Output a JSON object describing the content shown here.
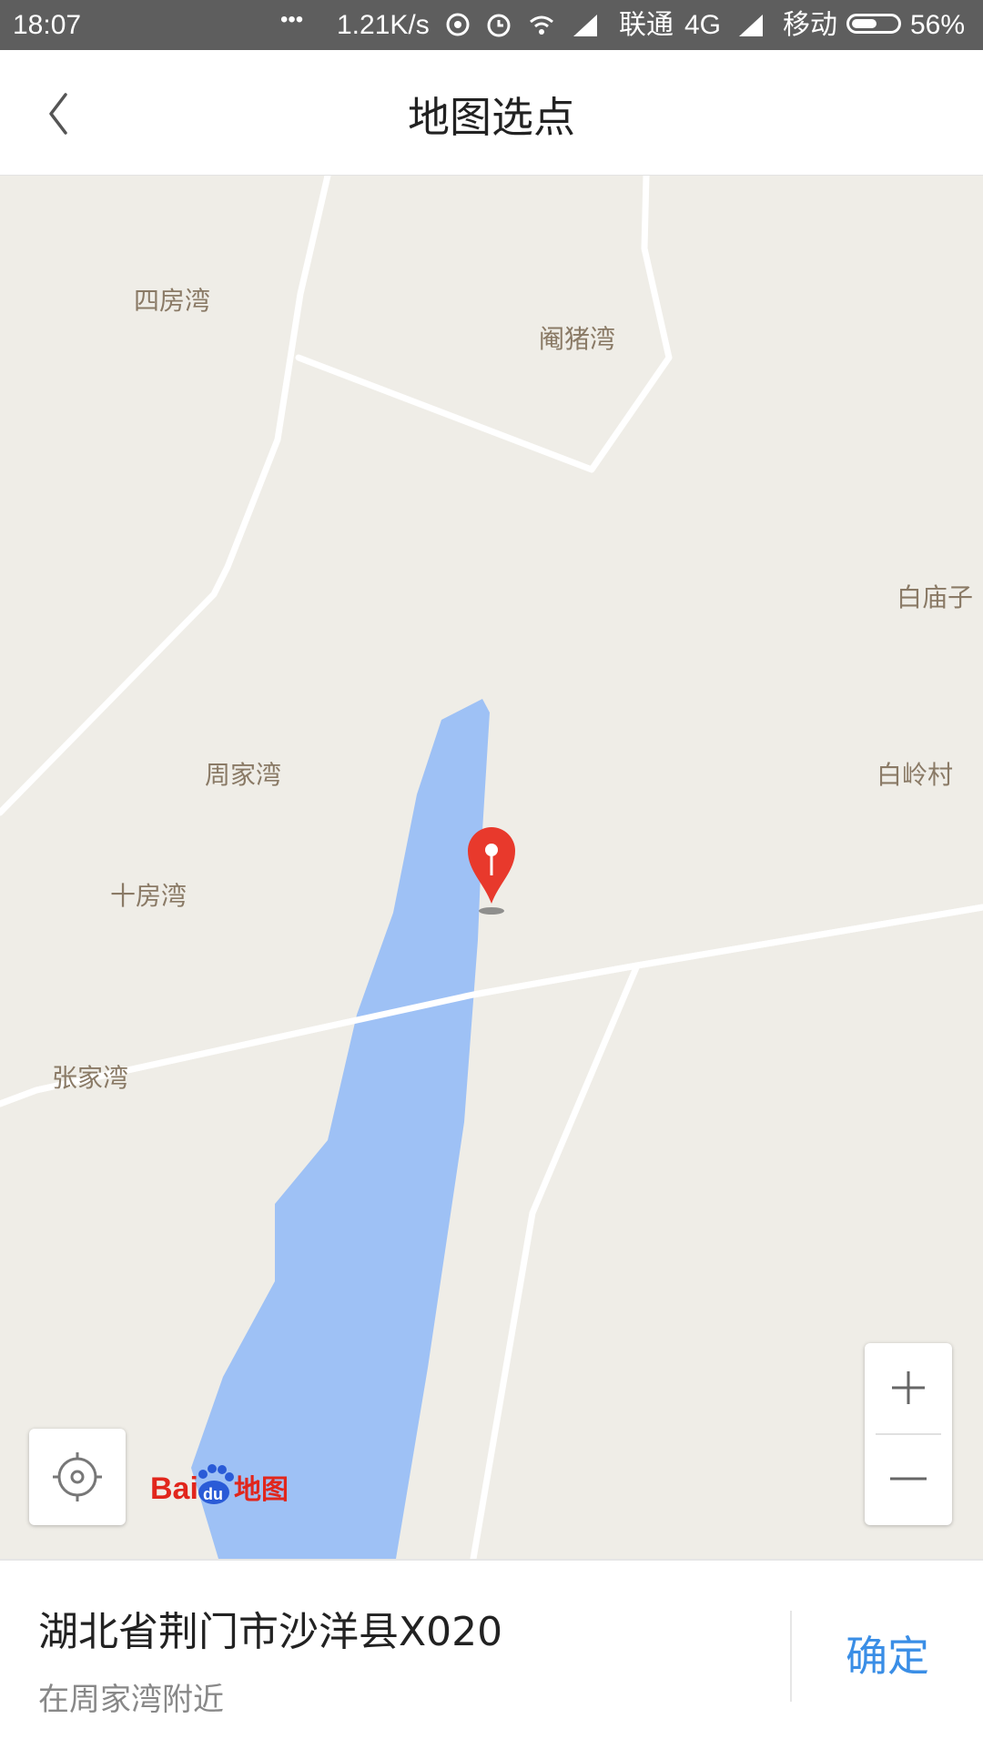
{
  "status_bar": {
    "time": "18:07",
    "dots": "•••",
    "speed": "1.21K/s",
    "carrier1": "联通",
    "network": "4G",
    "carrier2": "移动",
    "battery": "56%",
    "battery_level": 0.56,
    "icons": [
      "hotspot-icon",
      "alarm-icon",
      "wifi-icon",
      "signal-icon",
      "signal-icon",
      "battery-icon"
    ]
  },
  "header": {
    "title": "地图选点",
    "back_icon": "chevron-left-icon"
  },
  "map": {
    "places": [
      {
        "id": "sifangwan",
        "name": "四房湾"
      },
      {
        "id": "yanzhuwan",
        "name": "阉猪湾"
      },
      {
        "id": "baimiaozi",
        "name": "白庙子"
      },
      {
        "id": "zhoujiawan",
        "name": "周家湾"
      },
      {
        "id": "bailingcun",
        "name": "白岭村"
      },
      {
        "id": "shifangwan",
        "name": "十房湾"
      },
      {
        "id": "zhangjiawan",
        "name": "张家湾"
      }
    ],
    "pin_icon": "map-pin-icon",
    "locate_icon": "locate-icon",
    "zoom_in_icon": "plus-icon",
    "zoom_out_icon": "minus-icon",
    "logo": "Baidu地图",
    "colors": {
      "land": "#efede7",
      "water": "#9ec1f5",
      "road": "#ffffff",
      "pin": "#e8392c"
    }
  },
  "selection": {
    "address": "湖北省荆门市沙洋县X020",
    "nearby": "在周家湾附近",
    "confirm_label": "确定"
  }
}
